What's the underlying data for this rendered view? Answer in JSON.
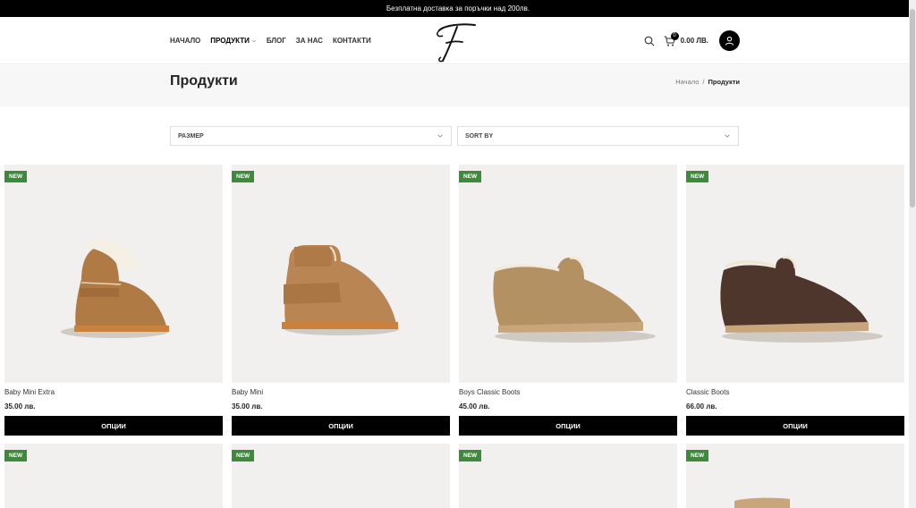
{
  "topbar": {
    "text": "Безплатна доставка за поръчки над 200лв."
  },
  "nav": {
    "items": [
      {
        "label": "НАЧАЛО",
        "active": false
      },
      {
        "label": "ПРОДУКТИ",
        "active": true,
        "has_dropdown": true
      },
      {
        "label": "БЛОГ",
        "active": false
      },
      {
        "label": "ЗА НАС",
        "active": false
      },
      {
        "label": "КОНТАКТИ",
        "active": false
      }
    ]
  },
  "header": {
    "logo_icon": "script-f-logo",
    "search_icon": "search-icon",
    "cart_icon": "cart-icon",
    "cart_count": "0",
    "cart_total": "0.00 ЛВ.",
    "account_icon": "user-icon"
  },
  "page": {
    "title": "Продукти",
    "breadcrumb": {
      "home": "Начало",
      "sep": "/",
      "current": "Продукти"
    }
  },
  "filters": {
    "size": {
      "label": "РАЗМЕР"
    },
    "sort": {
      "label": "SORT BY"
    }
  },
  "colors": {
    "badge": "#3d8a3b",
    "button": "#000000",
    "image_bg": "#f1f0ee"
  },
  "products": [
    {
      "name": "Baby Mini Extra",
      "price": "35.00 лв.",
      "badge": "NEW",
      "button": "ОПЦИИ"
    },
    {
      "name": "Baby Mini",
      "price": "35.00 лв.",
      "badge": "NEW",
      "button": "ОПЦИИ"
    },
    {
      "name": "Boys Classic Boots",
      "price": "45.00 лв.",
      "badge": "NEW",
      "button": "ОПЦИИ"
    },
    {
      "name": "Classic Boots",
      "price": "66.00 лв.",
      "badge": "NEW",
      "button": "ОПЦИИ"
    }
  ],
  "products_row2": [
    {
      "badge": "NEW"
    },
    {
      "badge": "NEW"
    },
    {
      "badge": "NEW"
    },
    {
      "badge": "NEW"
    }
  ]
}
